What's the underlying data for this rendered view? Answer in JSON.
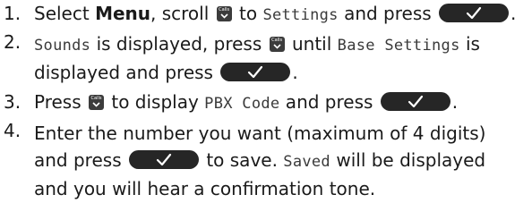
{
  "icons": {
    "ok_key": "ok-checkmark-key-icon",
    "calls_key": "calls-scroll-key-icon"
  },
  "colors": {
    "text": "#1a1a1a",
    "lcd_text": "#3a3a3a",
    "ok_key": "#262626",
    "calls_key": "#3c3c3c"
  },
  "calls_key_label": "Calls",
  "steps": [
    {
      "number": "1.",
      "parts": [
        "Select ",
        "Menu",
        ", scroll ",
        " to ",
        "Settings",
        " and press ",
        "."
      ]
    },
    {
      "number": "2.",
      "parts": [
        "Sounds",
        " is displayed, press ",
        " until ",
        "Base Settings",
        " is",
        "displayed and press ",
        "."
      ]
    },
    {
      "number": "3.",
      "parts": [
        "Press ",
        " to display ",
        "PBX Code",
        " and press ",
        "."
      ]
    },
    {
      "number": "4.",
      "parts": [
        "Enter the number you want (maximum of 4 digits)",
        "and press ",
        " to save. ",
        "Saved",
        " will be displayed",
        "and you will hear a confirmation tone."
      ]
    }
  ]
}
